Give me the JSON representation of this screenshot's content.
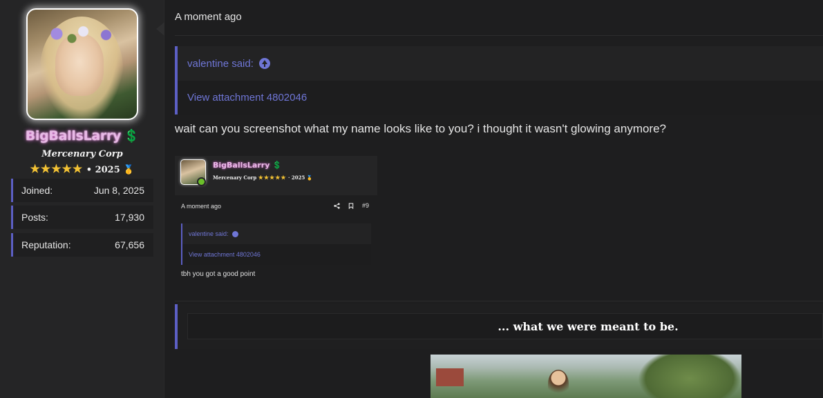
{
  "user": {
    "name": "BigBallsLarry",
    "name_emoji": "💲",
    "title": "Mercenary Corp",
    "stars": "★★★★★",
    "banner_text": "• 2025",
    "banner_emoji": "🥇",
    "stats": [
      {
        "label": "Joined:",
        "value": "Jun 8, 2025"
      },
      {
        "label": "Posts:",
        "value": "17,930"
      },
      {
        "label": "Reputation:",
        "value": "67,656"
      }
    ]
  },
  "post": {
    "time": "A moment ago",
    "quote": {
      "author_label": "valentine said:",
      "body": "View attachment 4802046"
    },
    "message": "wait can you screenshot what my name looks like to you? i thought it wasn't glowing anymore?"
  },
  "attachment": {
    "username": "BigBallsLarry",
    "name_emoji": "💲",
    "title": "Mercenary Corp",
    "stars": "★★★★★",
    "banner_text": "· 2025",
    "banner_emoji": "🥇",
    "time": "A moment ago",
    "post_number": "#9",
    "quote_author": "valentine said:",
    "quote_body": "View attachment 4802046",
    "message": "tbh you got a good point"
  },
  "signature": {
    "text": "... what we were meant to be."
  },
  "colors": {
    "accent": "#5c5fc4",
    "link": "#6f76d6",
    "name_glow": "#e06ad7"
  }
}
